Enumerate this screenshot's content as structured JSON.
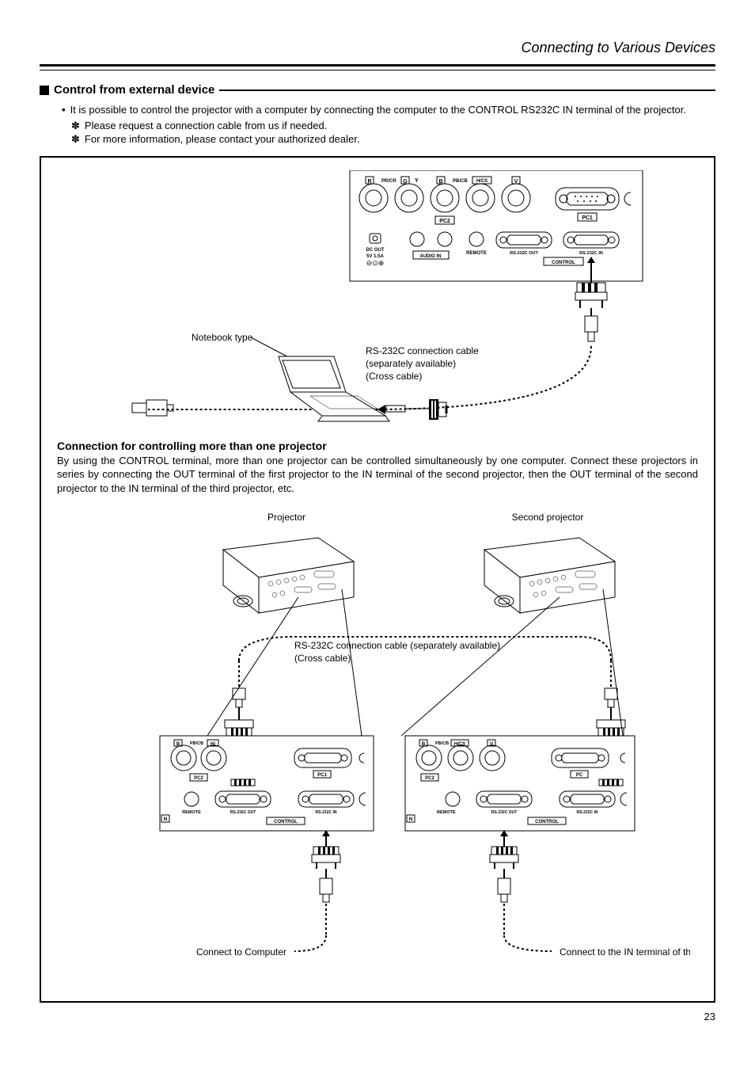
{
  "header": {
    "title": "Connecting to Various Devices"
  },
  "section": {
    "heading": "Control from external device",
    "bullet": "It is possible to control the projector with a computer by connecting the computer to the CONTROL RS232C IN terminal of the projector.",
    "sub1": "Please request a connection cable from us if needed.",
    "sub2": "For more information, please contact your authorized dealer."
  },
  "labels": {
    "notebook": "Notebook type",
    "rs232c_cable": "RS-232C connection cable",
    "separately": "(separately available)",
    "cross": "(Cross cable)",
    "projector": "Projector",
    "second_projector": "Second projector",
    "connect_computer": "Connect to Computer",
    "connect_third": "Connect to the IN terminal of third projector",
    "rs232c_cable_sep": "RS-232C connection cable (separately available)"
  },
  "panel": {
    "R": "R",
    "PRCR": "PR/CR",
    "G": "G",
    "Y": "Y",
    "B": "B",
    "PBCB": "PB/CB",
    "HCS": "H/CS",
    "H": "H/",
    "V": "V",
    "PC2": "PC2",
    "PC1": "PC1",
    "PC": "PC",
    "DCOUT": "DC OUT",
    "DCOUT2": "5V    1.5A",
    "AUDIOIN": "AUDIO IN",
    "REMOTE": "REMOTE",
    "RS232COUT": "RS-232C OUT",
    "RS232CIN": "RS-232C IN",
    "CONTROL": "CONTROL",
    "N": "N"
  },
  "subsection": {
    "title": "Connection for controlling more than one projector",
    "text": "By using the CONTROL terminal, more than one projector can be controlled simultaneously by one computer. Connect these projectors in series by connecting the OUT terminal of the first projector to the IN terminal of the second projector, then the OUT terminal of the second projector to the IN terminal of the third projector, etc."
  },
  "pageNumber": "23"
}
